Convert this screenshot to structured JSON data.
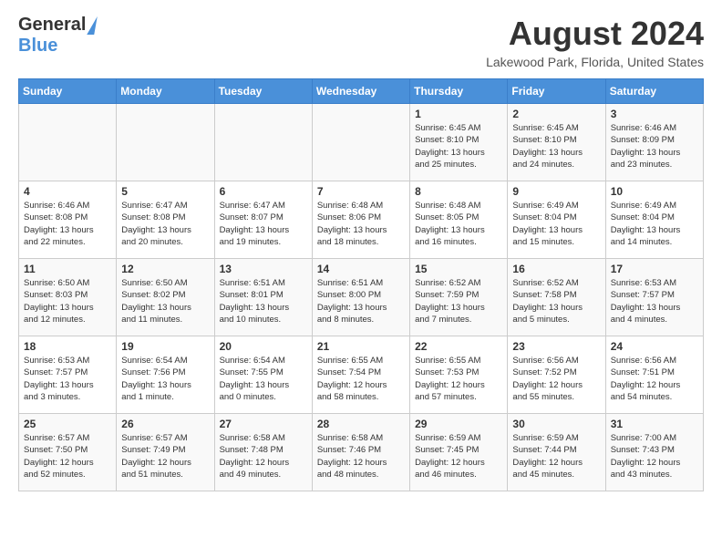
{
  "logo": {
    "line1": "General",
    "line2": "Blue"
  },
  "title": "August 2024",
  "subtitle": "Lakewood Park, Florida, United States",
  "days_of_week": [
    "Sunday",
    "Monday",
    "Tuesday",
    "Wednesday",
    "Thursday",
    "Friday",
    "Saturday"
  ],
  "weeks": [
    [
      {
        "day": "",
        "info": ""
      },
      {
        "day": "",
        "info": ""
      },
      {
        "day": "",
        "info": ""
      },
      {
        "day": "",
        "info": ""
      },
      {
        "day": "1",
        "info": "Sunrise: 6:45 AM\nSunset: 8:10 PM\nDaylight: 13 hours\nand 25 minutes."
      },
      {
        "day": "2",
        "info": "Sunrise: 6:45 AM\nSunset: 8:10 PM\nDaylight: 13 hours\nand 24 minutes."
      },
      {
        "day": "3",
        "info": "Sunrise: 6:46 AM\nSunset: 8:09 PM\nDaylight: 13 hours\nand 23 minutes."
      }
    ],
    [
      {
        "day": "4",
        "info": "Sunrise: 6:46 AM\nSunset: 8:08 PM\nDaylight: 13 hours\nand 22 minutes."
      },
      {
        "day": "5",
        "info": "Sunrise: 6:47 AM\nSunset: 8:08 PM\nDaylight: 13 hours\nand 20 minutes."
      },
      {
        "day": "6",
        "info": "Sunrise: 6:47 AM\nSunset: 8:07 PM\nDaylight: 13 hours\nand 19 minutes."
      },
      {
        "day": "7",
        "info": "Sunrise: 6:48 AM\nSunset: 8:06 PM\nDaylight: 13 hours\nand 18 minutes."
      },
      {
        "day": "8",
        "info": "Sunrise: 6:48 AM\nSunset: 8:05 PM\nDaylight: 13 hours\nand 16 minutes."
      },
      {
        "day": "9",
        "info": "Sunrise: 6:49 AM\nSunset: 8:04 PM\nDaylight: 13 hours\nand 15 minutes."
      },
      {
        "day": "10",
        "info": "Sunrise: 6:49 AM\nSunset: 8:04 PM\nDaylight: 13 hours\nand 14 minutes."
      }
    ],
    [
      {
        "day": "11",
        "info": "Sunrise: 6:50 AM\nSunset: 8:03 PM\nDaylight: 13 hours\nand 12 minutes."
      },
      {
        "day": "12",
        "info": "Sunrise: 6:50 AM\nSunset: 8:02 PM\nDaylight: 13 hours\nand 11 minutes."
      },
      {
        "day": "13",
        "info": "Sunrise: 6:51 AM\nSunset: 8:01 PM\nDaylight: 13 hours\nand 10 minutes."
      },
      {
        "day": "14",
        "info": "Sunrise: 6:51 AM\nSunset: 8:00 PM\nDaylight: 13 hours\nand 8 minutes."
      },
      {
        "day": "15",
        "info": "Sunrise: 6:52 AM\nSunset: 7:59 PM\nDaylight: 13 hours\nand 7 minutes."
      },
      {
        "day": "16",
        "info": "Sunrise: 6:52 AM\nSunset: 7:58 PM\nDaylight: 13 hours\nand 5 minutes."
      },
      {
        "day": "17",
        "info": "Sunrise: 6:53 AM\nSunset: 7:57 PM\nDaylight: 13 hours\nand 4 minutes."
      }
    ],
    [
      {
        "day": "18",
        "info": "Sunrise: 6:53 AM\nSunset: 7:57 PM\nDaylight: 13 hours\nand 3 minutes."
      },
      {
        "day": "19",
        "info": "Sunrise: 6:54 AM\nSunset: 7:56 PM\nDaylight: 13 hours\nand 1 minute."
      },
      {
        "day": "20",
        "info": "Sunrise: 6:54 AM\nSunset: 7:55 PM\nDaylight: 13 hours\nand 0 minutes."
      },
      {
        "day": "21",
        "info": "Sunrise: 6:55 AM\nSunset: 7:54 PM\nDaylight: 12 hours\nand 58 minutes."
      },
      {
        "day": "22",
        "info": "Sunrise: 6:55 AM\nSunset: 7:53 PM\nDaylight: 12 hours\nand 57 minutes."
      },
      {
        "day": "23",
        "info": "Sunrise: 6:56 AM\nSunset: 7:52 PM\nDaylight: 12 hours\nand 55 minutes."
      },
      {
        "day": "24",
        "info": "Sunrise: 6:56 AM\nSunset: 7:51 PM\nDaylight: 12 hours\nand 54 minutes."
      }
    ],
    [
      {
        "day": "25",
        "info": "Sunrise: 6:57 AM\nSunset: 7:50 PM\nDaylight: 12 hours\nand 52 minutes."
      },
      {
        "day": "26",
        "info": "Sunrise: 6:57 AM\nSunset: 7:49 PM\nDaylight: 12 hours\nand 51 minutes."
      },
      {
        "day": "27",
        "info": "Sunrise: 6:58 AM\nSunset: 7:48 PM\nDaylight: 12 hours\nand 49 minutes."
      },
      {
        "day": "28",
        "info": "Sunrise: 6:58 AM\nSunset: 7:46 PM\nDaylight: 12 hours\nand 48 minutes."
      },
      {
        "day": "29",
        "info": "Sunrise: 6:59 AM\nSunset: 7:45 PM\nDaylight: 12 hours\nand 46 minutes."
      },
      {
        "day": "30",
        "info": "Sunrise: 6:59 AM\nSunset: 7:44 PM\nDaylight: 12 hours\nand 45 minutes."
      },
      {
        "day": "31",
        "info": "Sunrise: 7:00 AM\nSunset: 7:43 PM\nDaylight: 12 hours\nand 43 minutes."
      }
    ]
  ]
}
